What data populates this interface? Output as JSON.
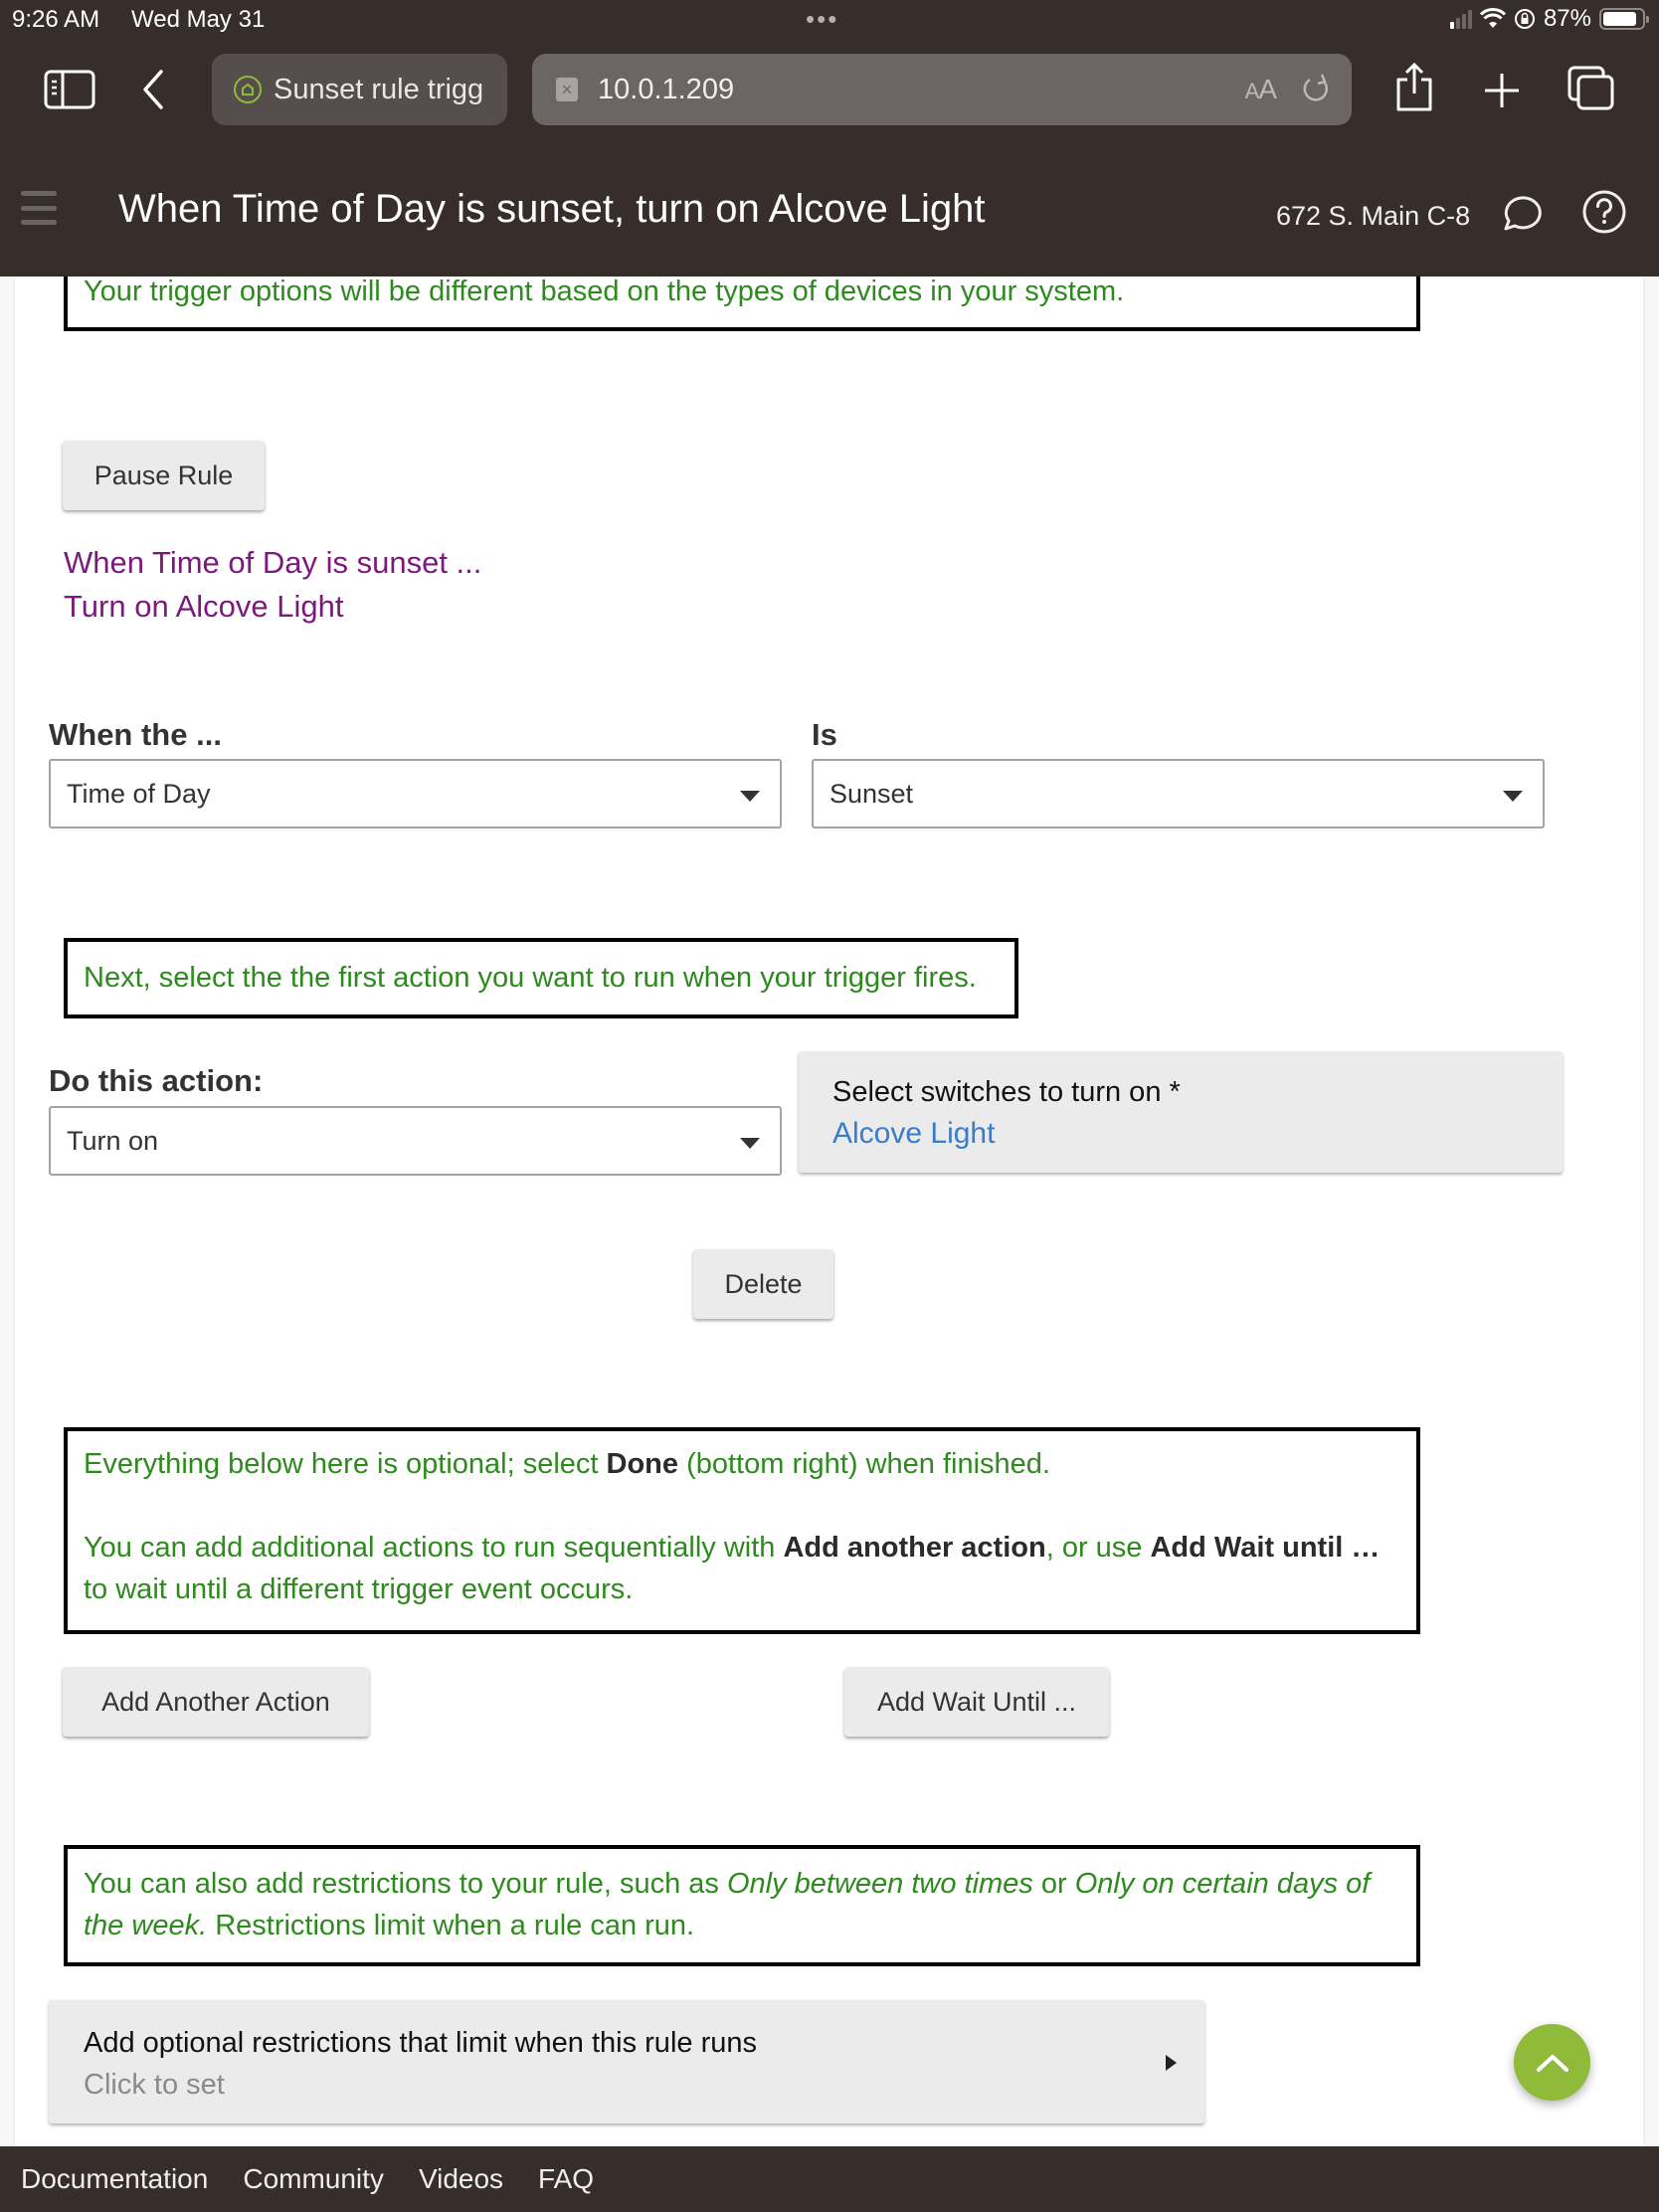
{
  "status_bar": {
    "time": "9:26 AM",
    "date": "Wed May 31",
    "battery": "87%",
    "battery_level": 0.87
  },
  "browser": {
    "tab_title": "Sunset rule trigg",
    "url": "10.0.1.209",
    "reader_label_small": "A",
    "reader_label_large": "A"
  },
  "header": {
    "title": "When Time of Day is sunset, turn on Alcove Light",
    "hub_name": "672 S. Main C-8"
  },
  "colors": {
    "chrome_bg": "#372e2c",
    "info_text": "#2e8a1f",
    "summary_text": "#7a1a7c",
    "link_blue": "#3a7cc8",
    "fab_green": "#8fba3a"
  },
  "content": {
    "trigger_note": "Your trigger options will be different based on the types of devices in your system.",
    "pause_button": "Pause Rule",
    "summary": {
      "line1": "When Time of Day is sunset ...",
      "line2": "Turn on Alcove Light"
    },
    "trigger": {
      "when_label": "When the ...",
      "when_value": "Time of Day",
      "is_label": "Is",
      "is_value": "Sunset"
    },
    "action_note": "Next, select the the first action you want to run when your trigger fires.",
    "action": {
      "label": "Do this action:",
      "value": "Turn on",
      "switch_prompt": "Select switches to turn on *",
      "switch_value": "Alcove Light"
    },
    "delete_button": "Delete",
    "optional_note": {
      "line1_pre": "Everything below here is optional; select ",
      "line1_bold": "Done",
      "line1_post": " (bottom right) when finished.",
      "line2_pre": "You can add additional actions to run sequentially with ",
      "line2_bold1": "Add another action",
      "line2_mid": ", or use ",
      "line2_bold2": "Add Wait until …",
      "line2_post": " to wait until a different trigger event occurs."
    },
    "add_action_button": "Add Another Action",
    "add_wait_button": "Add Wait Until ...",
    "restrictions_note": {
      "pre": "You can also add restrictions to your rule, such as ",
      "italic1": "Only between two times",
      "mid": " or ",
      "italic2": "Only on certain days of the week.",
      "post": "  Restrictions limit when a rule can run."
    },
    "restrictions_card": {
      "title": "Add optional restrictions that limit when this rule runs",
      "subtitle": "Click to set"
    }
  },
  "footer": {
    "links": [
      "Documentation",
      "Community",
      "Videos",
      "FAQ"
    ]
  }
}
